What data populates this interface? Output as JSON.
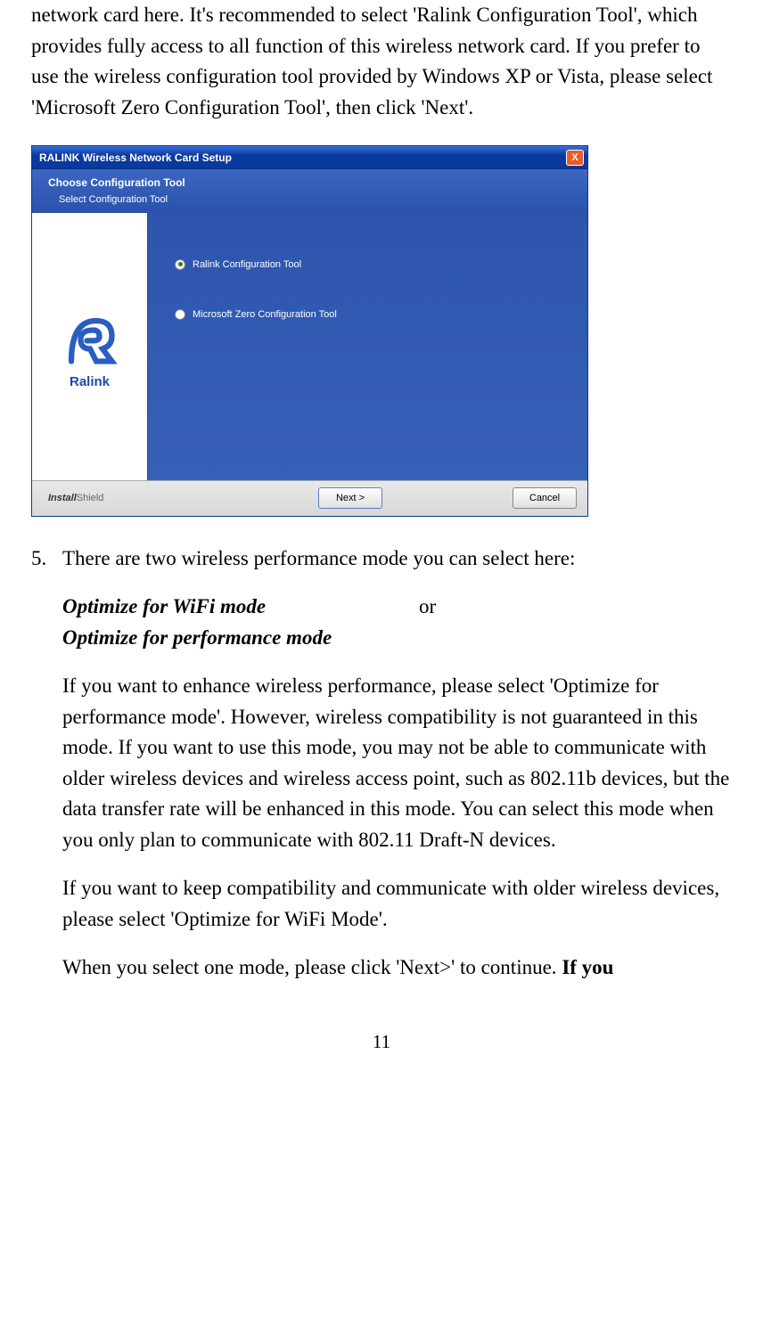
{
  "intro_text": "network card here. It's recommended to select 'Ralink Configuration Tool', which provides fully access to all function of this wireless network card. If you prefer to use the wireless configuration tool provided by Windows XP or Vista, please select 'Microsoft Zero Configuration Tool', then click 'Next'.",
  "screenshot": {
    "title": "RALINK Wireless Network Card Setup",
    "close_label": "X",
    "header_title": "Choose Configuration Tool",
    "header_desc": "Select Configuration Tool",
    "logo_text": "Ralink",
    "radio1": "Ralink Configuration Tool",
    "radio2": "Microsoft Zero Configuration Tool",
    "installshield_prefix": "Install",
    "installshield_suffix": "Shield",
    "next_btn": "Next >",
    "cancel_btn": "Cancel"
  },
  "step5": {
    "number": "5.",
    "intro": "There are two wireless performance mode you can select here:",
    "mode1": "Optimize for WiFi mode",
    "or": "or",
    "mode2": "Optimize for performance mode",
    "para1": "If you want to enhance wireless performance, please select 'Optimize for performance mode'. However, wireless compatibility is not guaranteed in this mode. If you want to use this mode, you may not be able to communicate with older wireless devices and wireless access point, such as 802.11b devices, but the data transfer rate will be enhanced in this mode. You can select this mode when you only plan to communicate with 802.11 Draft-N devices.",
    "para2": "If you want to keep compatibility and communicate with older wireless devices, please select 'Optimize for WiFi Mode'.",
    "para3_prefix": "When you select one mode, please click 'Next>' to continue. ",
    "para3_bold": "If you"
  },
  "page_number": "11"
}
